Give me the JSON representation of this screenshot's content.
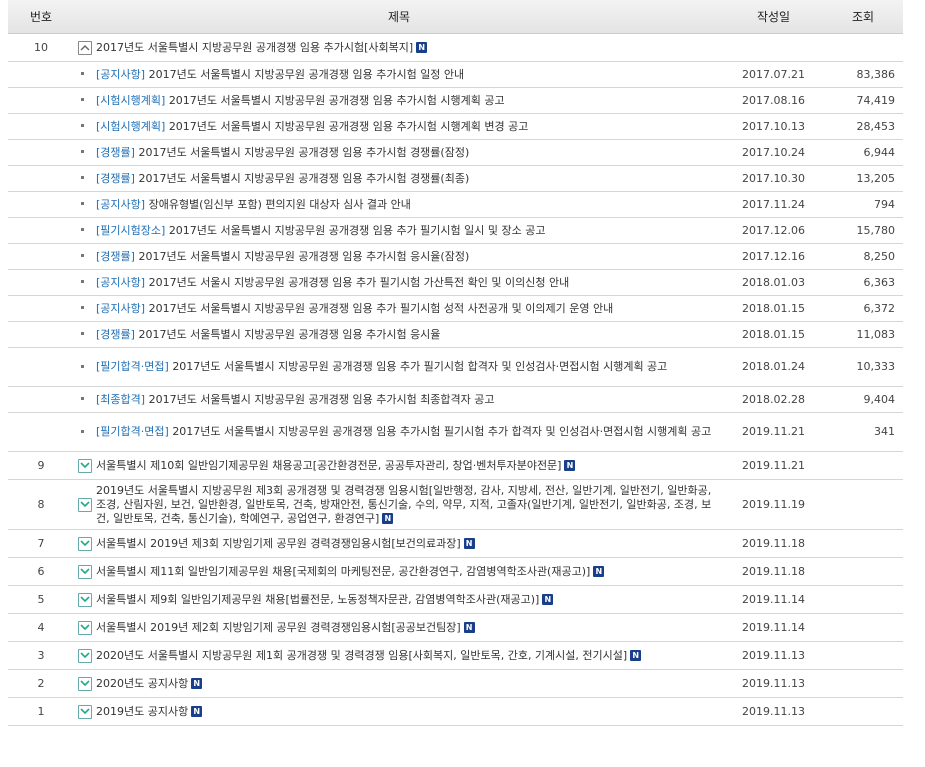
{
  "headers": {
    "num": "번호",
    "title": "제목",
    "date": "작성일",
    "views": "조회"
  },
  "badge": "N",
  "rows": [
    {
      "num": "10",
      "title": "2017년도 서울특별시 지방공무원 공개경쟁 임용 추가시험[사회복지]",
      "date": "",
      "expanded": true,
      "children": [
        {
          "cat": "[공지사항]",
          "title": "2017년도 서울특별시 지방공무원 공개경쟁 임용 추가시험 일정 안내",
          "date": "2017.07.21",
          "views": "83,386"
        },
        {
          "cat": "[시험시행계획]",
          "title": "2017년도 서울특별시 지방공무원 공개경쟁 임용 추가시험 시행계획 공고",
          "date": "2017.08.16",
          "views": "74,419"
        },
        {
          "cat": "[시험시행계획]",
          "title": "2017년도 서울특별시 지방공무원 공개경쟁 임용 추가시험 시행계획 변경 공고",
          "date": "2017.10.13",
          "views": "28,453"
        },
        {
          "cat": "[경쟁률]",
          "title": "2017년도 서울특별시 지방공무원 공개경쟁 임용 추가시험 경쟁률(잠정)",
          "date": "2017.10.24",
          "views": "6,944"
        },
        {
          "cat": "[경쟁률]",
          "title": "2017년도 서울특별시 지방공무원 공개경쟁 임용 추가시험 경쟁률(최종)",
          "date": "2017.10.30",
          "views": "13,205"
        },
        {
          "cat": "[공지사항]",
          "title": "장애유형별(임신부 포함) 편의지원 대상자 심사 결과 안내",
          "date": "2017.11.24",
          "views": "794"
        },
        {
          "cat": "[필기시험장소]",
          "title": "2017년도 서울특별시 지방공무원 공개경쟁 임용 추가 필기시험 일시 및 장소 공고",
          "date": "2017.12.06",
          "views": "15,780"
        },
        {
          "cat": "[경쟁률]",
          "title": "2017년도 서울특별시 지방공무원 공개경쟁 임용 추가시험 응시율(잠정)",
          "date": "2017.12.16",
          "views": "8,250"
        },
        {
          "cat": "[공지사항]",
          "title": "2017년도 서울시 지방공무원 공개경쟁 임용 추가 필기시험 가산특전 확인 및 이의신청 안내",
          "date": "2018.01.03",
          "views": "6,363"
        },
        {
          "cat": "[공지사항]",
          "title": "2017년도 서울특별시 지방공무원 공개경쟁 임용 추가 필기시험 성적 사전공개 및 이의제기 운영 안내",
          "date": "2018.01.15",
          "views": "6,372"
        },
        {
          "cat": "[경쟁률]",
          "title": "2017년도 서울특별시 지방공무원 공개경쟁 임용 추가시험 응시율",
          "date": "2018.01.15",
          "views": "11,083"
        },
        {
          "cat": "[필기합격·면접]",
          "title": "2017년도 서울특별시 지방공무원 공개경쟁 임용 추가 필기시험 합격자 및 인성검사·면접시험 시행계획 공고",
          "date": "2018.01.24",
          "views": "10,333",
          "two": true
        },
        {
          "cat": "[최종합격]",
          "title": "2017년도 서울특별시 지방공무원 공개경쟁 임용 추가시험 최종합격자 공고",
          "date": "2018.02.28",
          "views": "9,404"
        },
        {
          "cat": "[필기합격·면접]",
          "title": "2017년도 서울특별시 지방공무원 공개경쟁 임용 추가시험 필기시험 추가 합격자 및 인성검사·면접시험 시행계획 공고",
          "date": "2019.11.21",
          "views": "341",
          "two": true
        }
      ]
    },
    {
      "num": "9",
      "title": "서울특별시 제10회 일반임기제공무원 채용공고[공간환경전문, 공공투자관리, 창업·벤처투자분야전문]",
      "date": "2019.11.21"
    },
    {
      "num": "8",
      "title": "2019년도 서울특별시 지방공무원 제3회 공개경쟁 및 경력경쟁 임용시험[일반행정, 감사, 지방세, 전산, 일반기계, 일반전기, 일반화공, 조경, 산림자원, 보건, 일반환경, 일반토목, 건축, 방재안전, 통신기술, 수의, 약무, 지적, 고졸자(일반기계, 일반전기, 일반화공, 조경, 보건, 일반토목, 건축, 통신기술), 학예연구, 공업연구, 환경연구]",
      "date": "2019.11.19",
      "three": true
    },
    {
      "num": "7",
      "title": "서울특별시 2019년 제3회 지방임기제 공무원 경력경쟁임용시험[보건의료과장]",
      "date": "2019.11.18"
    },
    {
      "num": "6",
      "title": "서울특별시 제11회 일반임기제공무원 채용[국제회의 마케팅전문, 공간환경연구, 감염병역학조사관(재공고)]",
      "date": "2019.11.18"
    },
    {
      "num": "5",
      "title": "서울특별시 제9회 일반임기제공무원 채용[법률전문, 노동정책자문관, 감염병역학조사관(재공고)]",
      "date": "2019.11.14"
    },
    {
      "num": "4",
      "title": "서울특별시 2019년 제2회 지방임기제 공무원 경력경쟁임용시험[공공보건팀장]",
      "date": "2019.11.14"
    },
    {
      "num": "3",
      "title": "2020년도 서울특별시 지방공무원 제1회 공개경쟁 및 경력경쟁 임용[사회복지, 일반토목, 간호, 기계시설, 전기시설]",
      "date": "2019.11.13"
    },
    {
      "num": "2",
      "title": "2020년도 공지사항",
      "date": "2019.11.13"
    },
    {
      "num": "1",
      "title": "2019년도 공지사항",
      "date": "2019.11.13"
    }
  ]
}
